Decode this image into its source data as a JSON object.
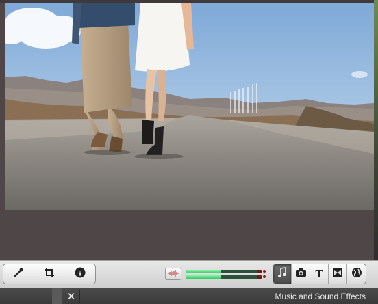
{
  "toolbar": {
    "left_tools": [
      {
        "name": "enhance-wand-button",
        "icon": "magic-wand-icon"
      },
      {
        "name": "crop-button",
        "icon": "crop-icon"
      },
      {
        "name": "info-button",
        "icon": "info-icon"
      }
    ],
    "right_tools": [
      {
        "name": "music-button",
        "icon": "music-note-icon",
        "active": true
      },
      {
        "name": "photos-button",
        "icon": "camera-icon",
        "active": false
      },
      {
        "name": "titles-button",
        "icon": "text-t-icon",
        "active": false
      },
      {
        "name": "transitions-button",
        "icon": "transition-icon",
        "active": false
      },
      {
        "name": "maps-button",
        "icon": "globe-icon",
        "active": false
      }
    ],
    "text_glyph": "T",
    "info_glyph": "i",
    "audio_skimming_icon": "audio-waveform-icon",
    "meters": {
      "left_level": 0.46,
      "right_level": 0.46,
      "meter_color": "#35d36f",
      "peak_color": "#8a1d1d"
    }
  },
  "statusbar": {
    "close_label": "✕",
    "title": "Music and Sound Effects"
  },
  "colors": {
    "background": "#4f4747",
    "toolbar": "#dcdcdc",
    "active_button": "#555555"
  }
}
